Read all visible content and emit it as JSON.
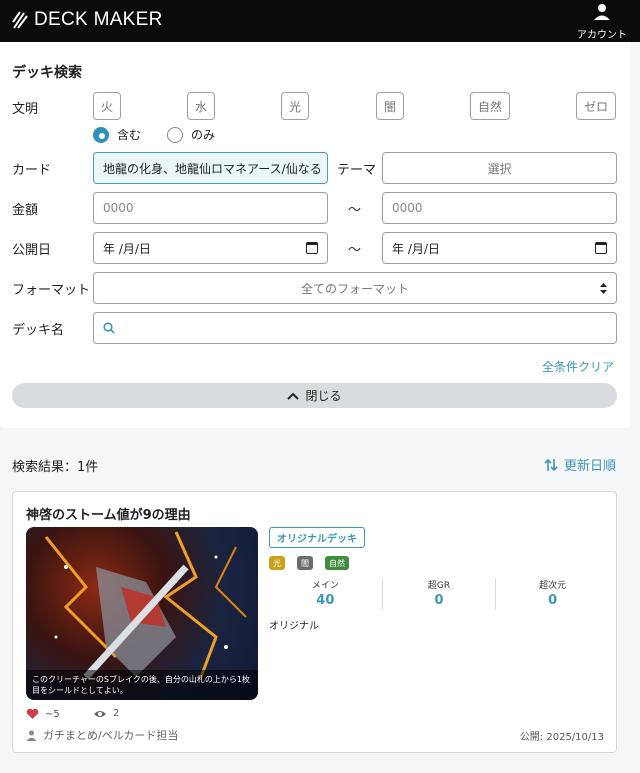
{
  "header": {
    "logo_text": "DECK MAKER",
    "account_label": "アカウント"
  },
  "search": {
    "title": "デッキ検索",
    "labels": {
      "civilization": "文明",
      "card": "カード",
      "theme": "テーマ",
      "price": "金額",
      "published": "公開日",
      "format": "フォーマット",
      "deck_name": "デッキ名"
    },
    "civilizations": [
      "火",
      "水",
      "光",
      "闇",
      "自然",
      "ゼロ"
    ],
    "match_modes": [
      {
        "label": "含む",
        "selected": true
      },
      {
        "label": "のみ",
        "selected": false
      }
    ],
    "card_value": "地龍の化身、地龍仙ロマネアース/仙なる",
    "theme_placeholder": "選択",
    "price_min_placeholder": "0000",
    "price_max_placeholder": "0000",
    "range_separator": "〜",
    "date_from": "年 /月/日",
    "date_to": "年 /月/日",
    "format_value": "全てのフォーマット",
    "deck_name_value": "",
    "clear_label": "全条件クリア",
    "close_label": "閉じる"
  },
  "results": {
    "count_label": "検索結果：1件",
    "sort_label": "更新日順",
    "decks": [
      {
        "title": "神啓のストーム値が9の理由",
        "thumbnail_caption": "このクリーチャーのSブレイクの後、自分の山札の上から1枚目をシールドとしてよい。",
        "badge": "オリジナルデッキ",
        "civs": [
          {
            "label": "光",
            "color": "#c9a21a"
          },
          {
            "label": "闇",
            "color": "#6b6b6b"
          },
          {
            "label": "自然",
            "color": "#3f8d3f"
          }
        ],
        "counts": [
          {
            "label": "メイン",
            "value": "40"
          },
          {
            "label": "超GR",
            "value": "0"
          },
          {
            "label": "超次元",
            "value": "0"
          }
        ],
        "format": "オリジナル",
        "likes": "~5",
        "views": "2",
        "author": "ガチまとめ/ベルカード担当",
        "published": "公開: 2025/10/13"
      }
    ]
  }
}
